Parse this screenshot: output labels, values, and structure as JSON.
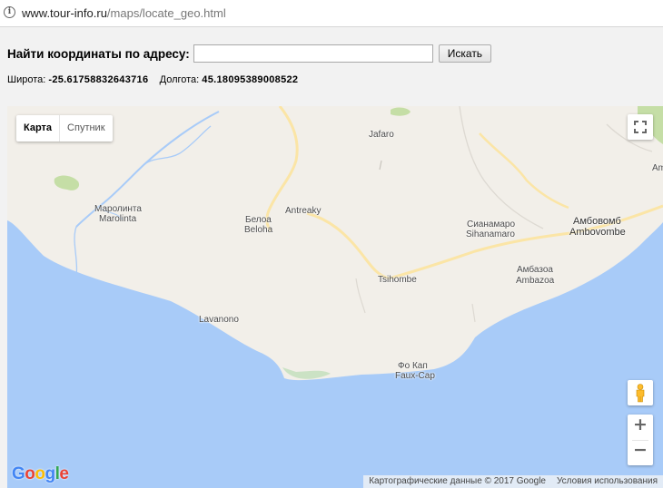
{
  "browser": {
    "url_host": "www.tour-info.ru",
    "url_path": "/maps/locate_geo.html"
  },
  "search": {
    "label": "Найти координаты по адресу:",
    "input_value": "",
    "button_label": "Искать"
  },
  "coords": {
    "lat_label": "Широта:",
    "lat_value": "-25.61758832643716",
    "lng_label": "Долгота:",
    "lng_value": "45.18095389008522"
  },
  "map": {
    "type_options": [
      "Карта",
      "Спутник"
    ],
    "selected_type": "Карта",
    "logo": "Google",
    "attribution": "Картографические данные © 2017 Google",
    "terms": "Условия использования",
    "labels": {
      "jafaro": "Jafaro",
      "marolinta_ru": "Маролинта",
      "marolinta": "Marolinta",
      "antreaky": "Antreaky",
      "beloha_ru": "Белоа",
      "beloha": "Beloha",
      "sihanamaro_ru": "Сианамаро",
      "sihanamaro": "Sihanamaro",
      "ambovombe_ru": "Амбовомб",
      "ambovombe": "Ambovombe",
      "am": "Am",
      "tsihombe": "Tsihombe",
      "ambazoa_ru": "Амбазоа",
      "ambazoa": "Ambazoa",
      "lavanono": "Lavanono",
      "fauxcap_ru": "Фо Кап",
      "fauxcap": "Faux-Cap"
    },
    "colors": {
      "land": "#f2efe9",
      "water": "#a8cbf8",
      "road": "#fbe5a6",
      "park": "#c5dea6"
    }
  }
}
